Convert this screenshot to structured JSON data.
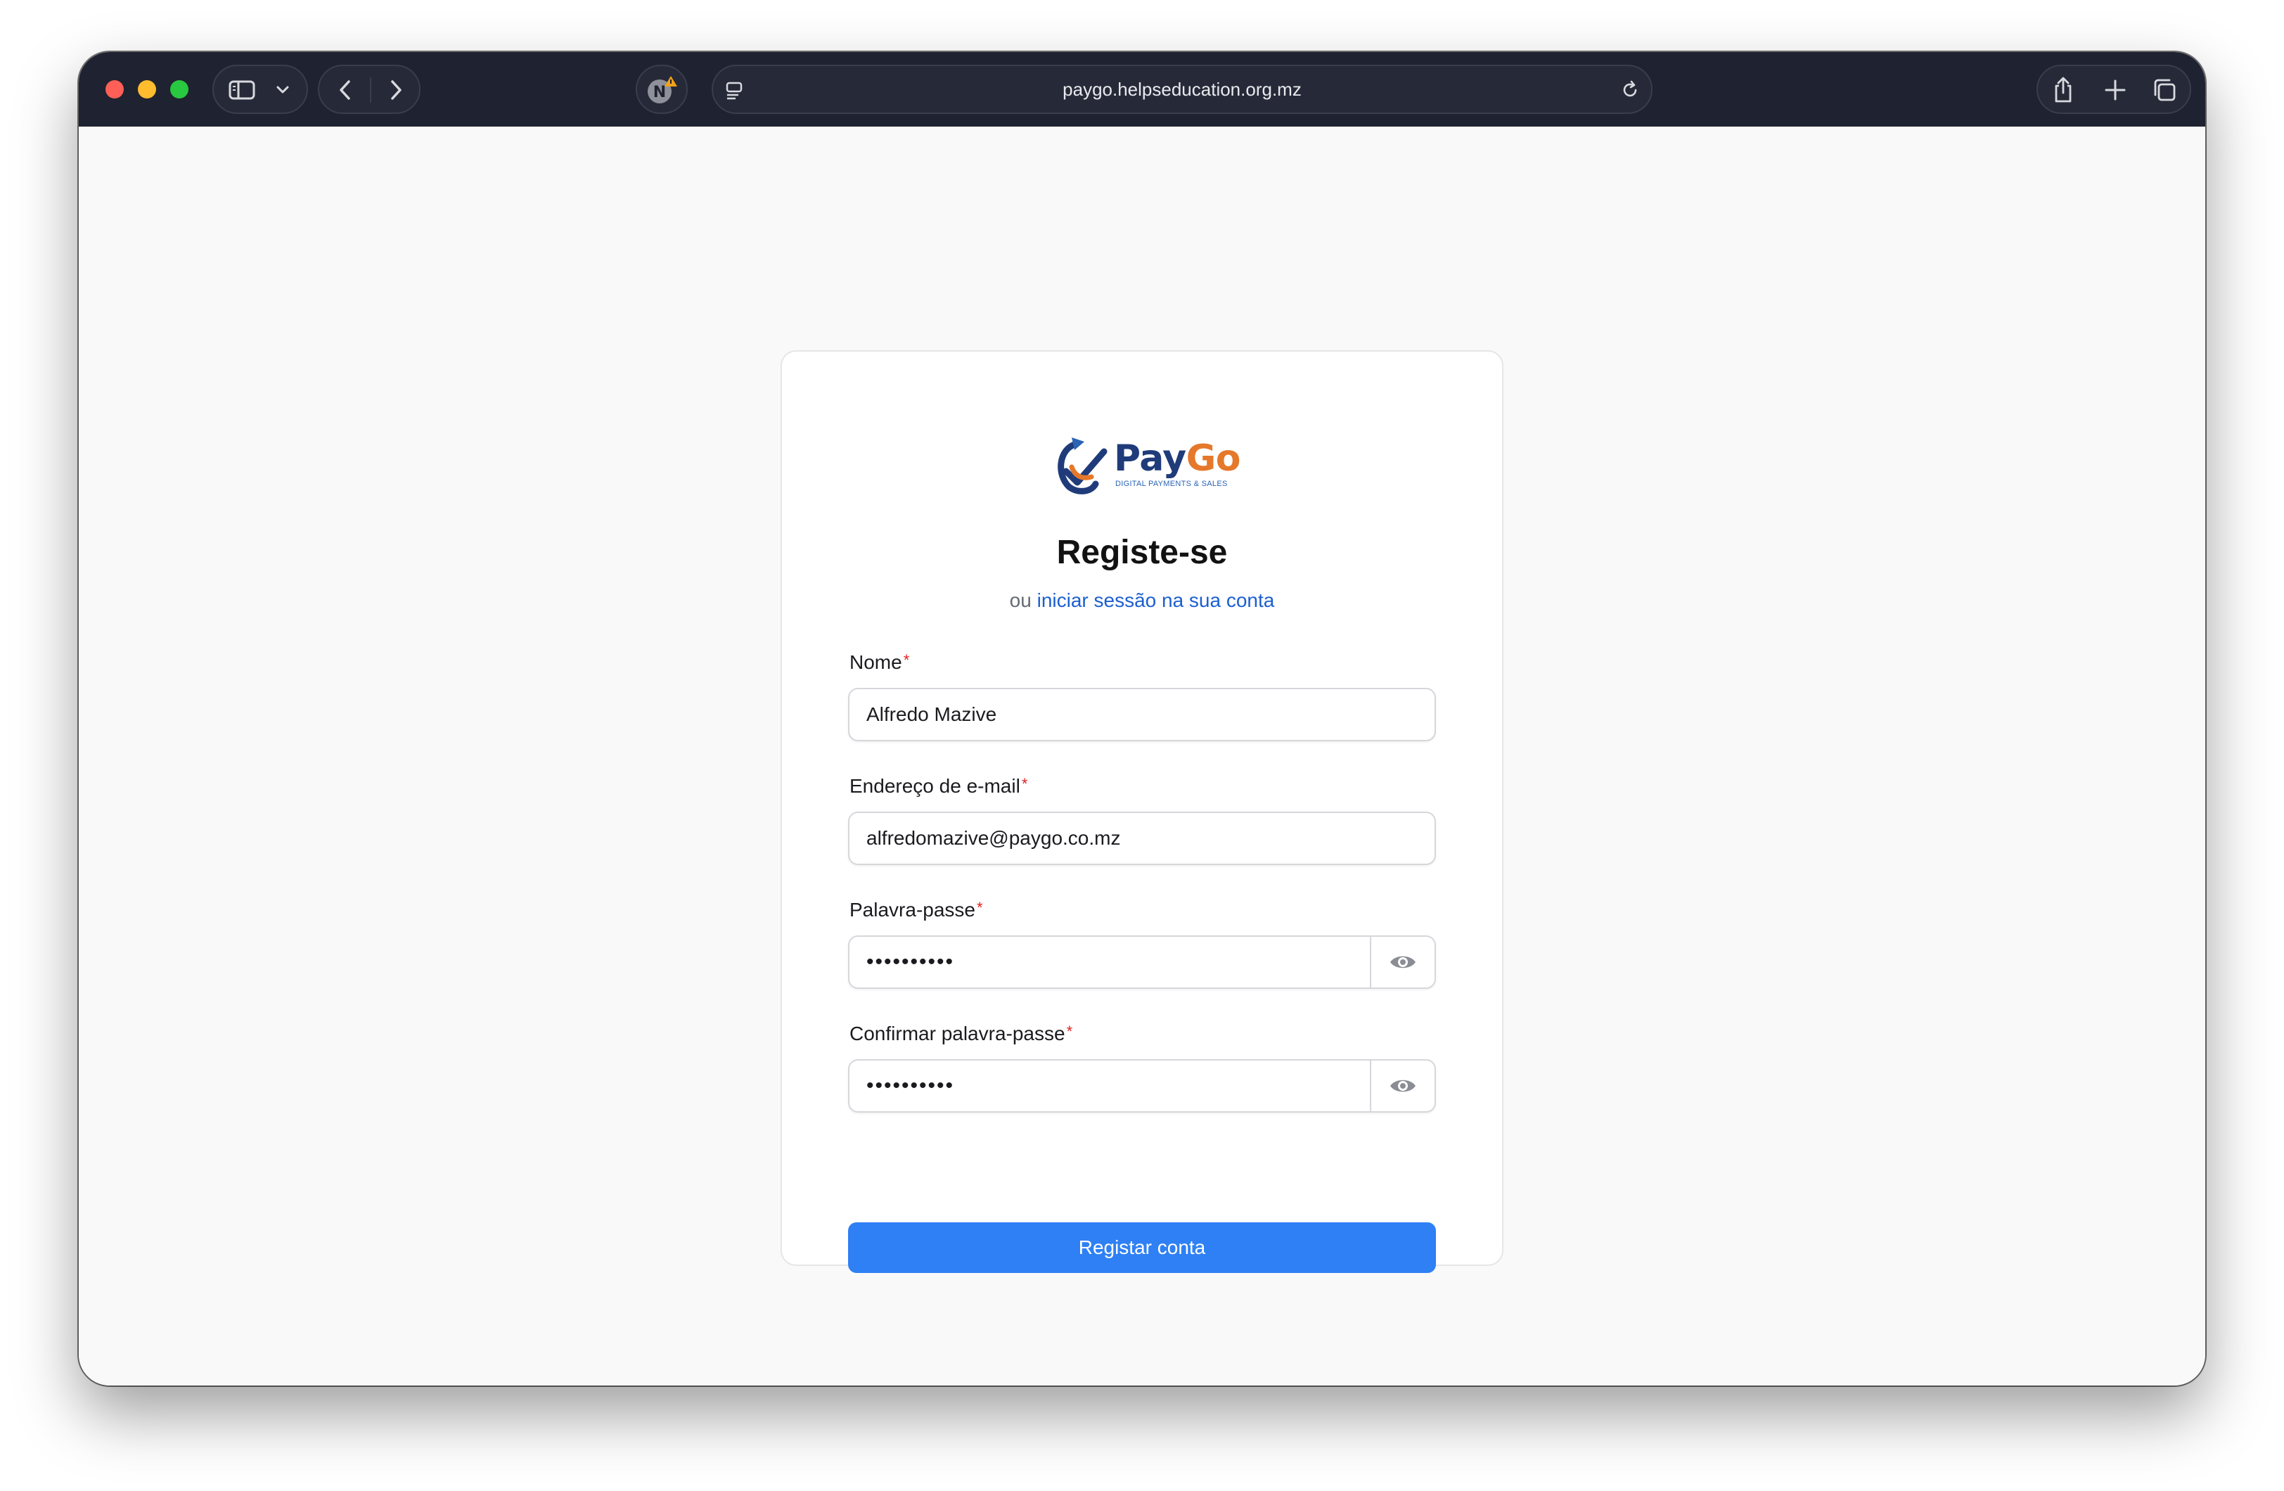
{
  "browser": {
    "url": "paygo.helpseducation.org.mz"
  },
  "brand": {
    "name_part1": "Pay",
    "name_part2": "Go",
    "tagline": "DIGITAL PAYMENTS & SALES",
    "primary_color": "#1f3b7a",
    "accent_color": "#e5782a"
  },
  "form": {
    "title": "Registe-se",
    "subtitle_prefix": "ou",
    "signin_link": "iniciar sessão na sua conta",
    "fields": {
      "name": {
        "label": "Nome",
        "required_mark": "*",
        "value": "Alfredo Mazive"
      },
      "email": {
        "label": "Endereço de e-mail",
        "required_mark": "*",
        "value": "alfredomazive@paygo.co.mz"
      },
      "password": {
        "label": "Palavra-passe",
        "required_mark": "*",
        "value": "••••••••••"
      },
      "confirm_password": {
        "label": "Confirmar palavra-passe",
        "required_mark": "*",
        "value": "••••••••••"
      }
    },
    "submit_label": "Registar conta",
    "button_color": "#2f80f4"
  }
}
